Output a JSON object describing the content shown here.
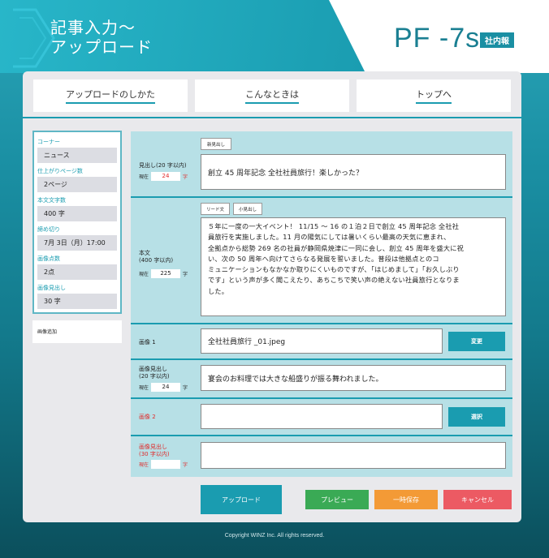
{
  "header": {
    "title_line1": "記事入力～",
    "title_line2": "アップロード",
    "brand": "PF -7s",
    "brand_badge": "社内報"
  },
  "nav": {
    "tabs": [
      "アップロードのしかた",
      "こんなときは",
      "トップへ"
    ]
  },
  "sidebar": {
    "items": [
      {
        "label": "コーナー",
        "value": "ニュース"
      },
      {
        "label": "仕上がりページ数",
        "value": "2ページ"
      },
      {
        "label": "本文文字数",
        "value": "400 字"
      },
      {
        "label": "締め切り",
        "value": "7月 3日（月）17:00"
      },
      {
        "label": "画像点数",
        "value": "2点"
      },
      {
        "label": "画像見出し",
        "value": "30 字"
      }
    ],
    "extra": "画像追加"
  },
  "form": {
    "headline": {
      "button": "新見出し",
      "label": "見出し(20 字以内)",
      "counter_prefix": "現在",
      "count": "24",
      "counter_unit": "字",
      "value": "創立 45 周年記念 全社社員旅行！楽しかった？"
    },
    "body": {
      "button_lead": "リード文",
      "button_sub": "小見出し",
      "label_line1": "本文",
      "label_line2": "(400 字以内)",
      "counter_prefix": "現在",
      "count": "225",
      "counter_unit": "字",
      "lines": [
        "５年に一度の一大イベント！ 11/15 ～ 16 の１泊２日で創立 45 周年記念 全社社",
        "員旅行を実施しました。11 月の陽気にしては暑いくらい最高の天気に恵まれ、",
        "全拠点から総勢 269 名の社員が静岡県焼津に一同に会し、創立 45 周年を盛大に祝",
        "い、次の 50 周年へ向けてさらなる発展を誓いました。普段は他拠点とのコ",
        "ミュニケーションもなかなか取りにくいものですが、「はじめまして」「お久しぶり",
        "です」という声が多く聞こえたり、あちこちで笑い声の絶えない社員旅行となりま",
        "した。"
      ]
    },
    "image1": {
      "label": "画像 1",
      "value": "全社社員旅行 _01.jpeg",
      "button": "変更"
    },
    "caption1": {
      "label_line1": "画像見出し",
      "label_line2": "(20 字以内)",
      "counter_prefix": "現在",
      "count": "24",
      "counter_unit": "字",
      "value": "宴会のお料理では大きな船盛りが振る舞われました。"
    },
    "image2": {
      "label": "画像 2",
      "value": "",
      "button": "選択"
    },
    "caption2": {
      "label_line1": "画像見出し",
      "label_line2": "(30 字以内)",
      "counter_prefix": "現在",
      "count": "",
      "counter_unit": "字",
      "value": ""
    }
  },
  "actions": {
    "upload": "アップロード",
    "preview": "プレビュー",
    "save": "一時保存",
    "cancel": "キャンセル"
  },
  "colors": {
    "accent": "#1a9cb0",
    "preview": "#3aaa55",
    "save": "#f39a36",
    "cancel": "#ec5a63",
    "required": "#e02b2b"
  },
  "footer": {
    "copyright": "Copyright WINZ Inc. All rights reserved."
  }
}
